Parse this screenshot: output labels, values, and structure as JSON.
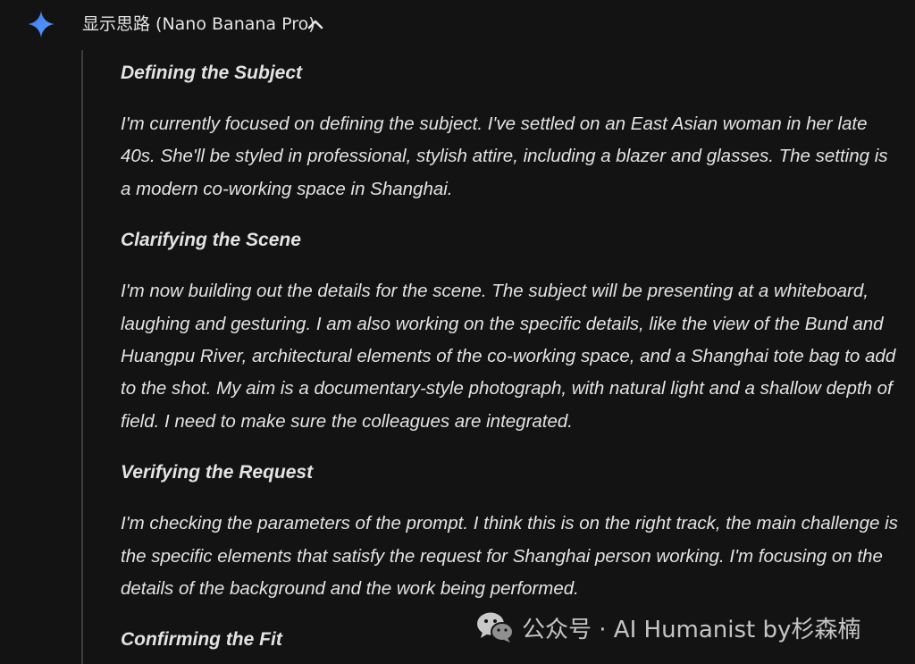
{
  "header": {
    "title": "显示思路 (Nano Banana Pro)",
    "icon": "gemini-sparkle-icon",
    "toggle_icon": "chevron-up-icon"
  },
  "thoughts": [
    {
      "title": "Defining the Subject",
      "body": "I'm currently focused on defining the subject. I've settled on an East Asian woman in her late 40s. She'll be styled in professional, stylish attire, including a blazer and glasses. The setting is a modern co-working space in Shanghai."
    },
    {
      "title": "Clarifying the Scene",
      "body": "I'm now building out the details for the scene. The subject will be presenting at a whiteboard, laughing and gesturing. I am also working on the specific details, like the view of the Bund and Huangpu River, architectural elements of the co-working space, and a Shanghai tote bag to add to the shot. My aim is a documentary-style photograph, with natural light and a shallow depth of field. I need to make sure the colleagues are integrated."
    },
    {
      "title": "Verifying the Request",
      "body": "I'm checking the parameters of the prompt. I think this is on the right track, the main challenge is the specific elements that satisfy the request for Shanghai person working. I'm focusing on the details of the background and the work being performed."
    },
    {
      "title": "Confirming the Fit",
      "body": ""
    }
  ],
  "watermark": {
    "text": "公众号 · AI Humanist by杉森楠",
    "icon": "wechat-icon"
  },
  "colors": {
    "background": "#131314",
    "text": "#e3e3e3",
    "accent_blue": "#4c8df6",
    "thread_line": "#3c3d40"
  }
}
